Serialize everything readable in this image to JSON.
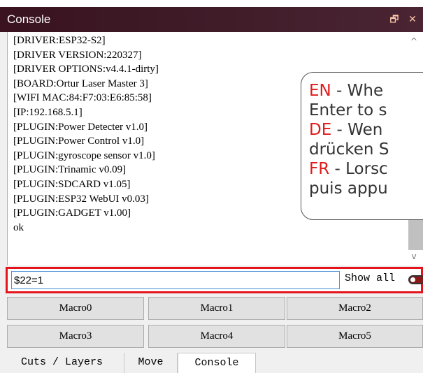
{
  "titlebar": {
    "title": "Console",
    "float_glyph": "🗗",
    "close_glyph": "✕"
  },
  "console": {
    "lines": [
      "[DRIVER:ESP32-S2]",
      "[DRIVER VERSION:220327]",
      "[DRIVER OPTIONS:v4.4.1-dirty]",
      "[BOARD:Ortur Laser Master 3]",
      "[WIFI MAC:84:F7:03:E6:85:58]",
      "[IP:192.168.5.1]",
      "[PLUGIN:Power Detecter v1.0]",
      "[PLUGIN:Power Control v1.0]",
      "[PLUGIN:gyroscope sensor v1.0]",
      "[PLUGIN:Trinamic v0.09]",
      "[PLUGIN:SDCARD v1.05]",
      "[PLUGIN:ESP32 WebUI v0.03]",
      "[PLUGIN:GADGET v1.00]",
      "ok"
    ],
    "scroll_up": "^",
    "scroll_down": "v"
  },
  "tooltip": {
    "en_code": "EN",
    "en_text": " - Whe",
    "en_cont": "Enter to s",
    "de_code": "DE",
    "de_text": " - Wen",
    "de_cont": "drücken S",
    "fr_code": "FR",
    "fr_text": " - Lorsc",
    "fr_cont": "puis appu"
  },
  "command": {
    "value": "$22=1",
    "show_all_label": "Show all",
    "show_all_on": true,
    "highlight_color": "#e3141b"
  },
  "macros": [
    "Macro0",
    "Macro1",
    "Macro2",
    "Macro3",
    "Macro4",
    "Macro5"
  ],
  "tabs": [
    {
      "label": "Cuts / Layers",
      "active": false
    },
    {
      "label": "Move",
      "active": false
    },
    {
      "label": "Console",
      "active": true
    }
  ]
}
